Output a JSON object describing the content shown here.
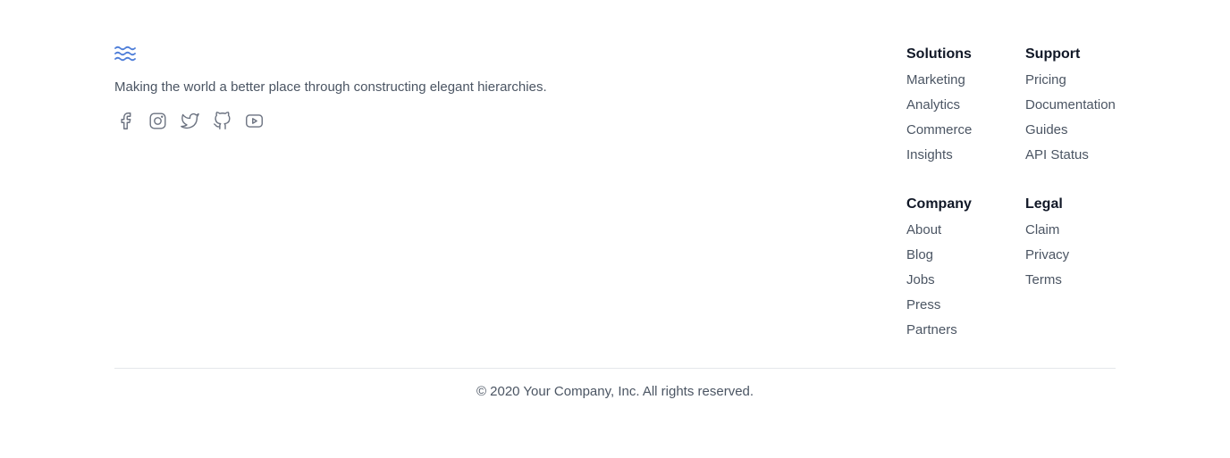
{
  "brand": {
    "logo_icon": "waves-logo-icon",
    "logo_color": "#4F7FD9",
    "tagline": "Making the world a better place through constructing elegant hierarchies."
  },
  "social": [
    {
      "icon": "facebook-icon"
    },
    {
      "icon": "instagram-icon"
    },
    {
      "icon": "twitter-icon"
    },
    {
      "icon": "github-icon"
    },
    {
      "icon": "youtube-icon"
    }
  ],
  "columns": {
    "solutions": {
      "heading": "Solutions",
      "links": [
        "Marketing",
        "Analytics",
        "Commerce",
        "Insights"
      ]
    },
    "support": {
      "heading": "Support",
      "links": [
        "Pricing",
        "Documentation",
        "Guides",
        "API Status"
      ]
    },
    "company": {
      "heading": "Company",
      "links": [
        "About",
        "Blog",
        "Jobs",
        "Press",
        "Partners"
      ]
    },
    "legal": {
      "heading": "Legal",
      "links": [
        "Claim",
        "Privacy",
        "Terms"
      ]
    }
  },
  "copyright": "© 2020 Your Company, Inc. All rights reserved.",
  "colors": {
    "heading": "#111827",
    "text": "#4B5563",
    "icon": "#6B7280",
    "divider": "#E5E7EB"
  }
}
